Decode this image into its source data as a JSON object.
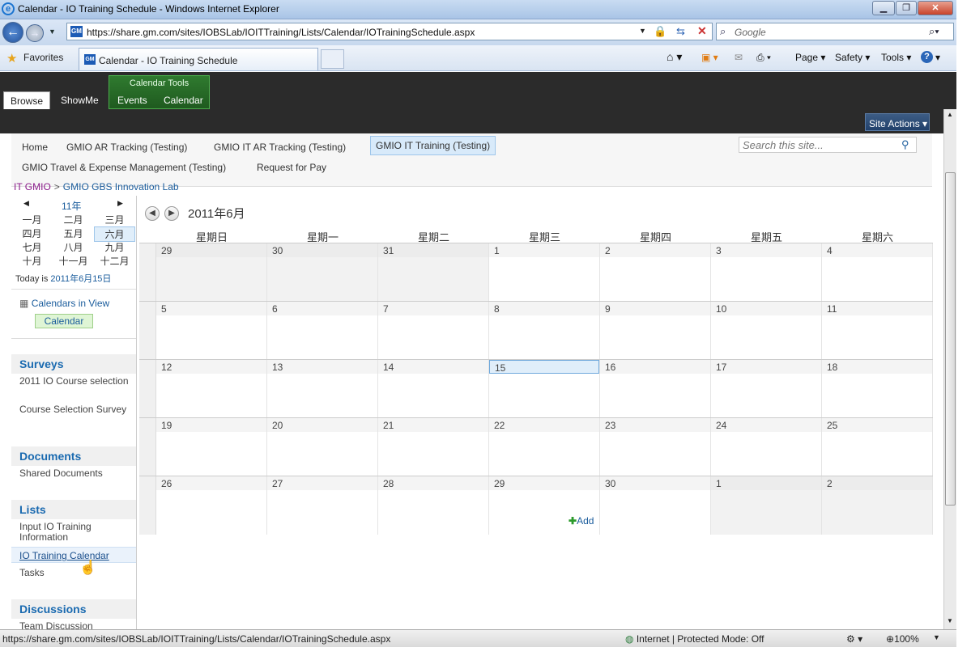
{
  "window": {
    "title": "Calendar - IO Training Schedule - Windows Internet Explorer"
  },
  "address": {
    "url": "https://share.gm.com/sites/IOBSLab/IOITTraining/Lists/Calendar/IOTrainingSchedule.aspx",
    "search_placeholder": "Google"
  },
  "favorites": {
    "label": "Favorites",
    "tab_title": "Calendar - IO Training Schedule"
  },
  "command_bar": {
    "page": "Page",
    "safety": "Safety",
    "tools": "Tools",
    "help": "?"
  },
  "ribbon": {
    "context_group": "Calendar Tools",
    "tabs": [
      "Browse",
      "ShowMe",
      "Events",
      "Calendar"
    ]
  },
  "site_actions": "Site Actions",
  "topnav": {
    "items": [
      "Home",
      "GMIO AR Tracking (Testing)",
      "GMIO IT AR Tracking (Testing)",
      "GMIO IT Training (Testing)",
      "GMIO Travel & Expense Management (Testing)",
      "Request for Pay"
    ],
    "search_placeholder": "Search this site..."
  },
  "breadcrumb": {
    "root": "IT GMIO",
    "sep": ">",
    "current": "GMIO GBS Innovation Lab"
  },
  "datepicker": {
    "year": "11年",
    "months": [
      "一月",
      "二月",
      "三月",
      "四月",
      "五月",
      "六月",
      "七月",
      "八月",
      "九月",
      "十月",
      "十一月",
      "十二月"
    ],
    "today_label": "Today is",
    "today_date": "2011年6月15日"
  },
  "leftnav": {
    "calendars_in_view": "Calendars in View",
    "calendar_chip": "Calendar",
    "surveys": {
      "heading": "Surveys",
      "items": [
        "2011 IO Course selection",
        "Course Selection Survey"
      ]
    },
    "documents": {
      "heading": "Documents",
      "items": [
        "Shared Documents"
      ]
    },
    "lists": {
      "heading": "Lists",
      "items": [
        "Input IO Training Information",
        "IO Training Calendar",
        "Tasks"
      ]
    },
    "discussions": {
      "heading": "Discussions",
      "items": [
        "Team Discussion"
      ]
    }
  },
  "calendar": {
    "month_title": "2011年6月",
    "days_of_week": [
      "星期日",
      "星期一",
      "星期二",
      "星期三",
      "星期四",
      "星期五",
      "星期六"
    ],
    "weeks": [
      [
        "29",
        "30",
        "31",
        "1",
        "2",
        "3",
        "4"
      ],
      [
        "5",
        "6",
        "7",
        "8",
        "9",
        "10",
        "11"
      ],
      [
        "12",
        "13",
        "14",
        "15",
        "16",
        "17",
        "18"
      ],
      [
        "19",
        "20",
        "21",
        "22",
        "23",
        "24",
        "25"
      ],
      [
        "26",
        "27",
        "28",
        "29",
        "30",
        "1",
        "2"
      ]
    ],
    "today": "15",
    "add_label": "Add"
  },
  "status": {
    "url": "https://share.gm.com/sites/IOBSLab/IOITTraining/Lists/Calendar/IOTrainingSchedule.aspx",
    "zone": "Internet | Protected Mode: Off",
    "zoom": "100%"
  }
}
